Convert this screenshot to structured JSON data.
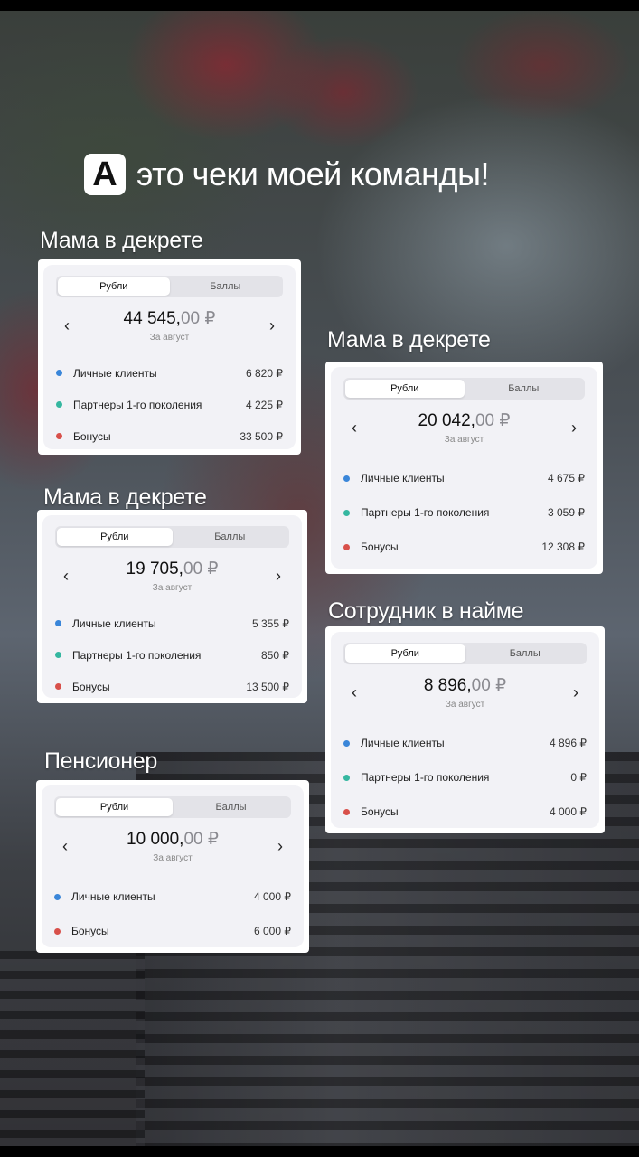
{
  "colors": {
    "blue": "#3a86d9",
    "teal": "#35b7a0",
    "red": "#d8504a"
  },
  "headline": {
    "badge": "А",
    "text": "это чеки моей команды!"
  },
  "cards": [
    {
      "label": "Мама в декрете",
      "tabs": {
        "active": "Рубли",
        "inactive": "Баллы"
      },
      "amount_main": "44 545,",
      "amount_dec": "00 ₽",
      "period": "За август",
      "rows": [
        {
          "color": "blue",
          "label": "Личные клиенты",
          "value": "6 820 ₽"
        },
        {
          "color": "teal",
          "label": "Партнеры 1-го поколения",
          "value": "4 225 ₽"
        },
        {
          "color": "red",
          "label": "Бонусы",
          "value": "33 500 ₽"
        }
      ]
    },
    {
      "label": "Мама в декрете",
      "tabs": {
        "active": "Рубли",
        "inactive": "Баллы"
      },
      "amount_main": "20 042,",
      "amount_dec": "00 ₽",
      "period": "За август",
      "rows": [
        {
          "color": "blue",
          "label": "Личные клиенты",
          "value": "4 675 ₽"
        },
        {
          "color": "teal",
          "label": "Партнеры 1-го поколения",
          "value": "3 059 ₽"
        },
        {
          "color": "red",
          "label": "Бонусы",
          "value": "12 308 ₽"
        }
      ]
    },
    {
      "label": "Мама в декрете",
      "tabs": {
        "active": "Рубли",
        "inactive": "Баллы"
      },
      "amount_main": "19 705,",
      "amount_dec": "00 ₽",
      "period": "За август",
      "rows": [
        {
          "color": "blue",
          "label": "Личные клиенты",
          "value": "5 355 ₽"
        },
        {
          "color": "teal",
          "label": "Партнеры 1-го поколения",
          "value": "850 ₽"
        },
        {
          "color": "red",
          "label": "Бонусы",
          "value": "13 500 ₽"
        }
      ]
    },
    {
      "label": "Сотрудник в найме",
      "tabs": {
        "active": "Рубли",
        "inactive": "Баллы"
      },
      "amount_main": "8 896,",
      "amount_dec": "00 ₽",
      "period": "За август",
      "rows": [
        {
          "color": "blue",
          "label": "Личные клиенты",
          "value": "4 896 ₽"
        },
        {
          "color": "teal",
          "label": "Партнеры 1-го поколения",
          "value": "0 ₽"
        },
        {
          "color": "red",
          "label": "Бонусы",
          "value": "4 000 ₽"
        }
      ]
    },
    {
      "label": "Пенсионер",
      "tabs": {
        "active": "Рубли",
        "inactive": "Баллы"
      },
      "amount_main": "10 000,",
      "amount_dec": "00 ₽",
      "period": "За август",
      "rows": [
        {
          "color": "blue",
          "label": "Личные клиенты",
          "value": "4 000 ₽"
        },
        {
          "color": "red",
          "label": "Бонусы",
          "value": "6 000 ₽"
        }
      ]
    }
  ]
}
